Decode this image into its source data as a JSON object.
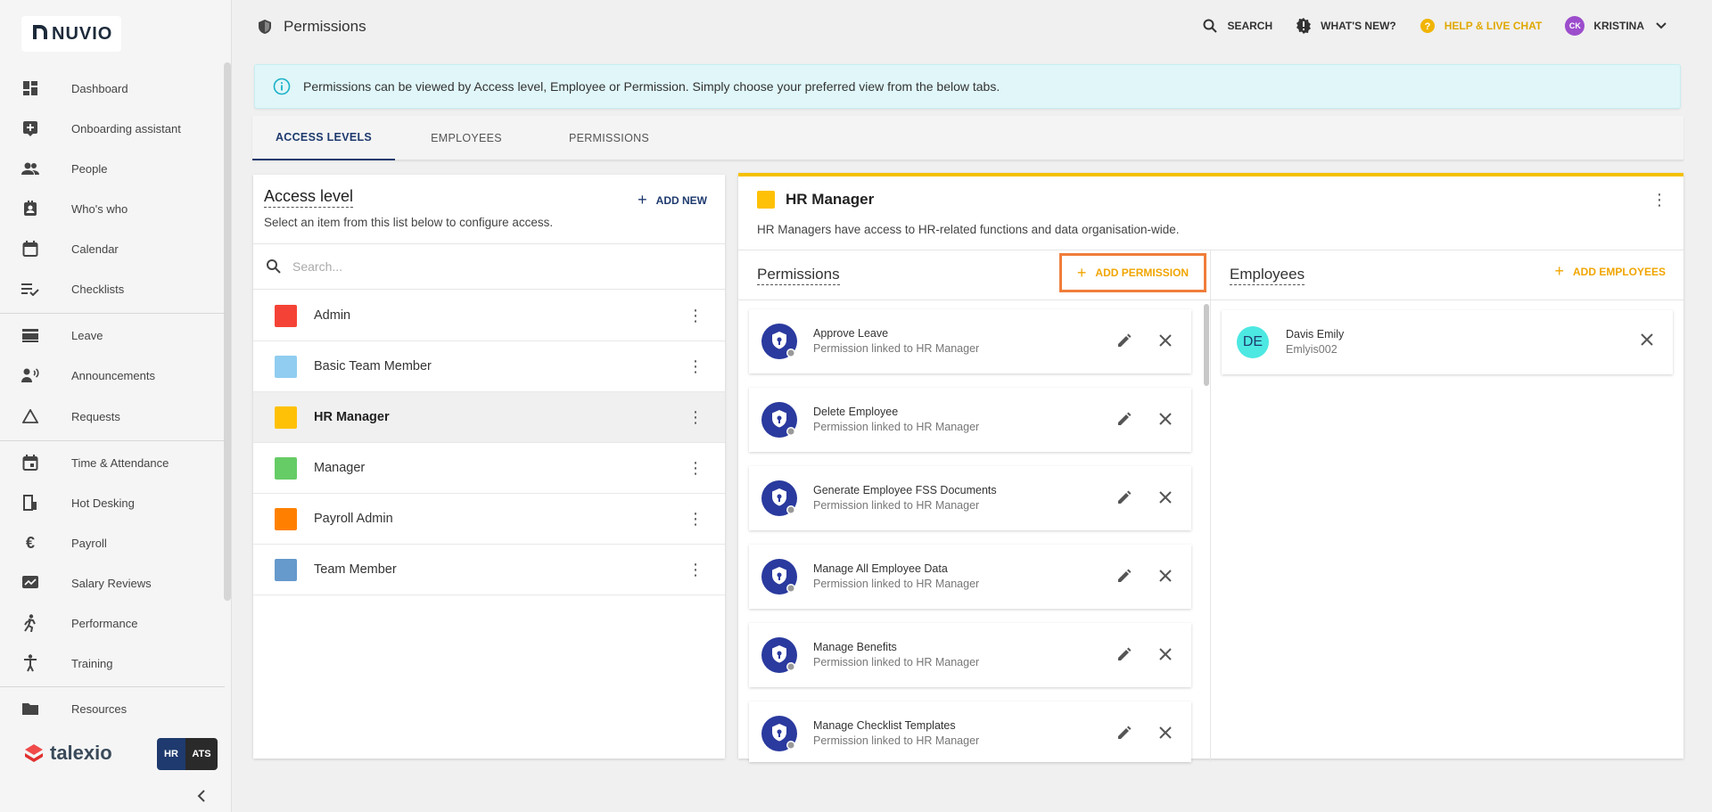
{
  "brand": {
    "name": "NUVIO"
  },
  "sidebar": {
    "items": [
      {
        "label": "Dashboard",
        "icon": "dashboard-icon"
      },
      {
        "label": "Onboarding assistant",
        "icon": "onboarding-icon"
      },
      {
        "label": "People",
        "icon": "people-icon"
      },
      {
        "label": "Who's who",
        "icon": "contact-card-icon"
      },
      {
        "label": "Calendar",
        "icon": "calendar-icon"
      },
      {
        "label": "Checklists",
        "icon": "checklist-icon"
      },
      {
        "label": "Leave",
        "icon": "leave-icon"
      },
      {
        "label": "Announcements",
        "icon": "announcement-icon"
      },
      {
        "label": "Requests",
        "icon": "requests-icon"
      },
      {
        "label": "Time & Attendance",
        "icon": "time-attendance-icon"
      },
      {
        "label": "Hot Desking",
        "icon": "hot-desking-icon"
      },
      {
        "label": "Payroll",
        "icon": "euro-icon"
      },
      {
        "label": "Salary Reviews",
        "icon": "salary-review-icon"
      },
      {
        "label": "Performance",
        "icon": "performance-icon"
      },
      {
        "label": "Training",
        "icon": "training-icon"
      },
      {
        "label": "Resources",
        "icon": "folder-icon"
      }
    ],
    "footer": {
      "product": "talexio",
      "switch_hr": "HR",
      "switch_ats": "ATS"
    }
  },
  "header": {
    "title": "Permissions",
    "search": "SEARCH",
    "whats_new": "WHAT'S NEW?",
    "help": "HELP & LIVE CHAT",
    "user_initials": "CK",
    "user_name": "KRISTINA"
  },
  "info_banner": "Permissions can be viewed by Access level, Employee or Permission. Simply choose your preferred view from the below tabs.",
  "tabs": [
    {
      "label": "ACCESS LEVELS",
      "active": true
    },
    {
      "label": "EMPLOYEES",
      "active": false
    },
    {
      "label": "PERMISSIONS",
      "active": false
    }
  ],
  "access_panel": {
    "title": "Access level",
    "subtitle": "Select an item from this list below to configure access.",
    "add_new": "ADD NEW",
    "search_placeholder": "Search...",
    "levels": [
      {
        "name": "Admin",
        "color": "#f44336",
        "selected": false
      },
      {
        "name": "Basic Team Member",
        "color": "#90cdf0",
        "selected": false
      },
      {
        "name": "HR Manager",
        "color": "#ffc107",
        "selected": true
      },
      {
        "name": "Manager",
        "color": "#66cc66",
        "selected": false
      },
      {
        "name": "Payroll Admin",
        "color": "#ff8000",
        "selected": false
      },
      {
        "name": "Team Member",
        "color": "#6699cc",
        "selected": false
      }
    ]
  },
  "detail": {
    "title": "HR Manager",
    "color": "#ffc107",
    "description": "HR Managers have access to HR-related functions and data organisation-wide.",
    "permissions_title": "Permissions",
    "add_permission": "ADD PERMISSION",
    "employees_title": "Employees",
    "add_employees": "ADD EMPLOYEES",
    "permissions": [
      {
        "name": "Approve Leave",
        "sub": "Permission linked to HR Manager"
      },
      {
        "name": "Delete Employee",
        "sub": "Permission linked to HR Manager"
      },
      {
        "name": "Generate Employee FSS Documents",
        "sub": "Permission linked to HR Manager"
      },
      {
        "name": "Manage All Employee Data",
        "sub": "Permission linked to HR Manager"
      },
      {
        "name": "Manage Benefits",
        "sub": "Permission linked to HR Manager"
      },
      {
        "name": "Manage Checklist Templates",
        "sub": "Permission linked to HR Manager"
      }
    ],
    "employees": [
      {
        "initials": "DE",
        "name": "Davis Emily",
        "username": "Emlyis002"
      }
    ]
  }
}
